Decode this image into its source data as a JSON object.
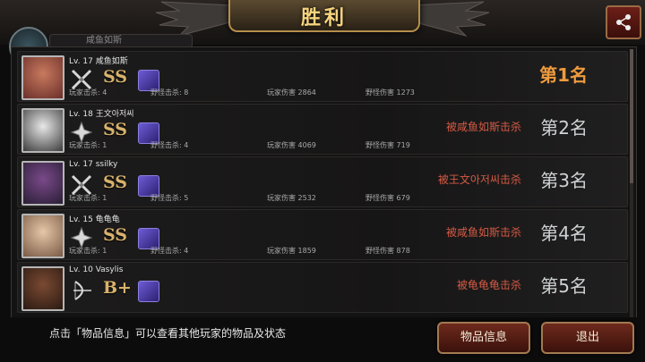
{
  "header": {
    "title": "胜利",
    "behind_tab": "咸鱼如斯"
  },
  "players": [
    {
      "level": "Lv. 17",
      "name": "咸鱼如斯",
      "weapon": "crossed-blades-icon",
      "grade": "SS",
      "player_kills": "玩家击杀: 4",
      "monster_kills": "野怪击杀: 8",
      "player_damage": "玩家伤害 2864",
      "monster_damage": "野怪伤害 1273",
      "killed_by": "",
      "rank": "第1名"
    },
    {
      "level": "Lv. 18",
      "name": "王文아저씨",
      "weapon": "shuriken-icon",
      "grade": "SS",
      "player_kills": "玩家击杀: 1",
      "monster_kills": "野怪击杀: 4",
      "player_damage": "玩家伤害 4069",
      "monster_damage": "野怪伤害 719",
      "killed_by": "被咸鱼如斯击杀",
      "rank": "第2名"
    },
    {
      "level": "Lv. 17",
      "name": "ssilky",
      "weapon": "crossed-blades-icon",
      "grade": "SS",
      "player_kills": "玩家击杀: 1",
      "monster_kills": "野怪击杀: 5",
      "player_damage": "玩家伤害 2532",
      "monster_damage": "野怪伤害 679",
      "killed_by": "被王文아저씨击杀",
      "rank": "第3名"
    },
    {
      "level": "Lv. 15",
      "name": "龟龟龟",
      "weapon": "shuriken-icon",
      "grade": "SS",
      "player_kills": "玩家击杀: 1",
      "monster_kills": "野怪击杀: 4",
      "player_damage": "玩家伤害 1859",
      "monster_damage": "野怪伤害 878",
      "killed_by": "被咸鱼如斯击杀",
      "rank": "第4名"
    },
    {
      "level": "Lv. 10",
      "name": "Vasylis",
      "weapon": "bow-icon",
      "grade": "B+",
      "player_kills": "",
      "monster_kills": "",
      "player_damage": "",
      "monster_damage": "",
      "killed_by": "被龟龟龟击杀",
      "rank": "第5名"
    }
  ],
  "footer": {
    "hint": "点击「物品信息」可以查看其他玩家的物品及状态",
    "items_button": "物品信息",
    "exit_button": "退出"
  },
  "icons": {
    "share": "share-icon"
  },
  "colors": {
    "gold": "#f6d47e",
    "rank_first": "#ee9b3e",
    "killed_by": "#d45a44",
    "button_red": "#6e2a1c"
  }
}
